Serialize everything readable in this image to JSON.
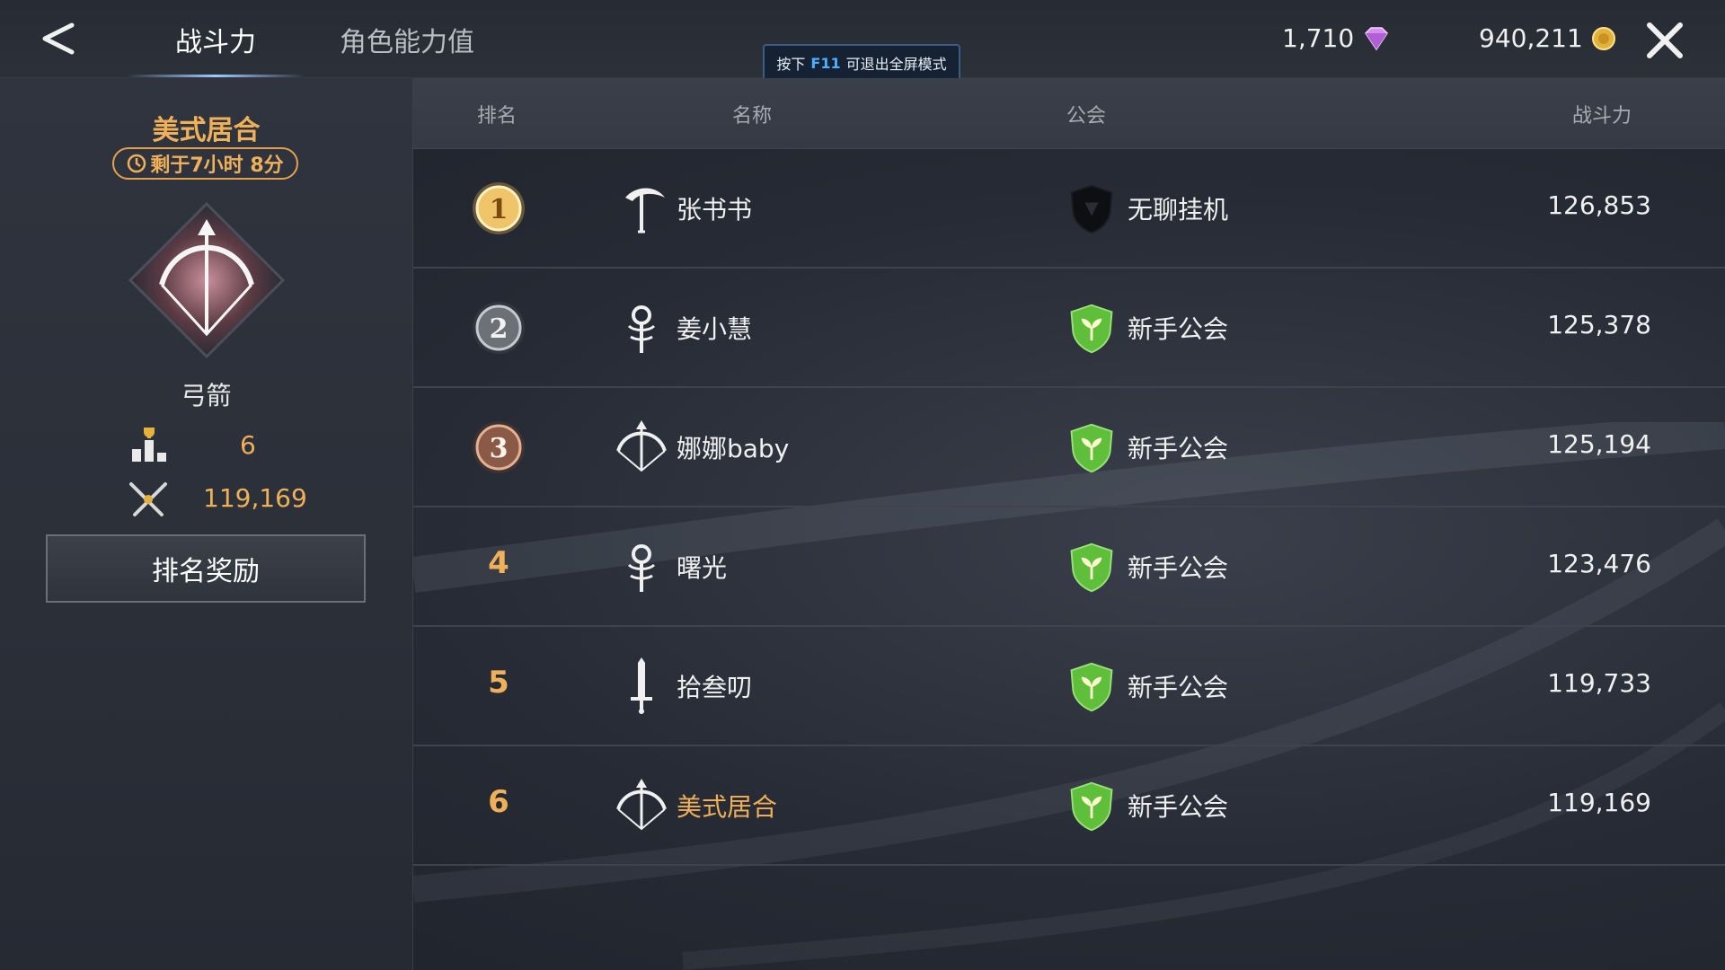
{
  "header": {
    "tabs": [
      {
        "label": "战斗力",
        "active": true
      },
      {
        "label": "角色能力值",
        "active": false
      }
    ],
    "currency": {
      "gems": "1,710",
      "gold": "940,211"
    },
    "toast": {
      "prefix": "按下",
      "key": "F11",
      "suffix": "可退出全屏模式"
    }
  },
  "left_panel": {
    "player_name": "美式居合",
    "timer": "剩于7小时 8分",
    "class_label": "弓箭",
    "rank": "6",
    "power": "119,169",
    "reward_button": "排名奖励"
  },
  "table": {
    "columns": {
      "rank": "排名",
      "name": "名称",
      "guild": "公会",
      "power": "战斗力"
    },
    "rows": [
      {
        "rank": "1",
        "name": "张书书",
        "class_icon": "scythe-icon",
        "guild": "无聊挂机",
        "guild_icon": "dark-shield-icon",
        "power": "126,853"
      },
      {
        "rank": "2",
        "name": "姜小慧",
        "class_icon": "staff-icon",
        "guild": "新手公会",
        "guild_icon": "green-shield-icon",
        "power": "125,378"
      },
      {
        "rank": "3",
        "name": "娜娜baby",
        "class_icon": "bow-icon",
        "guild": "新手公会",
        "guild_icon": "green-shield-icon",
        "power": "125,194"
      },
      {
        "rank": "4",
        "name": "曙光",
        "class_icon": "staff-icon",
        "guild": "新手公会",
        "guild_icon": "green-shield-icon",
        "power": "123,476"
      },
      {
        "rank": "5",
        "name": "拾叁叨",
        "class_icon": "sword-icon",
        "guild": "新手公会",
        "guild_icon": "green-shield-icon",
        "power": "119,733"
      },
      {
        "rank": "6",
        "name": "美式居合",
        "class_icon": "bow-icon",
        "guild": "新手公会",
        "guild_icon": "green-shield-icon",
        "power": "119,169",
        "self": true
      }
    ]
  },
  "colors": {
    "accent_gold": "#f0b05a",
    "guild_green": "#5fbf3a",
    "background": "#262b35"
  }
}
